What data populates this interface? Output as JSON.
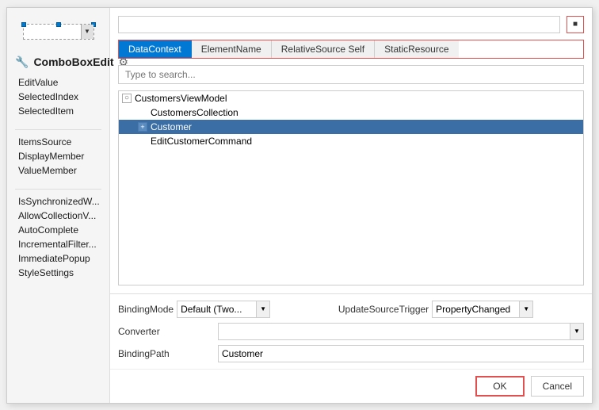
{
  "header": {
    "title": "ComboBoxEdit",
    "icon_wrench": "🔧",
    "icon_gear": "⚙"
  },
  "design_surface": {
    "widget_arrow": "▼",
    "resize_handle_label": "resize-handle"
  },
  "left_panel": {
    "properties": [
      {
        "label": "EditValue",
        "group": 1
      },
      {
        "label": "SelectedIndex",
        "group": 1
      },
      {
        "label": "SelectedItem",
        "group": 1
      },
      {
        "label": "ItemsSource",
        "group": 2
      },
      {
        "label": "DisplayMember",
        "group": 2
      },
      {
        "label": "ValueMember",
        "group": 2
      },
      {
        "label": "IsSynchronizedW...",
        "group": 3
      },
      {
        "label": "AllowCollectionV...",
        "group": 3
      },
      {
        "label": "AutoComplete",
        "group": 3
      },
      {
        "label": "IncrementalFilter...",
        "group": 3
      },
      {
        "label": "ImmediatePopup",
        "group": 3
      },
      {
        "label": "StyleSettings",
        "group": 3
      }
    ]
  },
  "dialog": {
    "value_input_placeholder": "",
    "tabs": [
      {
        "label": "DataContext",
        "active": true
      },
      {
        "label": "ElementName",
        "active": false
      },
      {
        "label": "RelativeSource Self",
        "active": false
      },
      {
        "label": "StaticResource",
        "active": false
      }
    ],
    "search_placeholder": "Type to search...",
    "tree": {
      "items": [
        {
          "label": "CustomersViewModel",
          "level": "root",
          "has_expander": true,
          "expander_symbol": "○",
          "selected": false
        },
        {
          "label": "CustomersCollection",
          "level": "child1",
          "has_expander": false,
          "selected": false
        },
        {
          "label": "Customer",
          "level": "child1",
          "has_expander": true,
          "expander_symbol": "+",
          "selected": true
        },
        {
          "label": "EditCustomerCommand",
          "level": "child1",
          "has_expander": false,
          "selected": false
        }
      ]
    },
    "bottom": {
      "binding_mode_label": "BindingMode",
      "binding_mode_value": "Default (Two...",
      "update_source_label": "UpdateSourceTrigger",
      "update_source_value": "PropertyChanged",
      "converter_label": "Converter",
      "converter_value": "",
      "binding_path_label": "BindingPath",
      "binding_path_value": "Customer"
    },
    "buttons": {
      "ok": "OK",
      "cancel": "Cancel"
    }
  }
}
